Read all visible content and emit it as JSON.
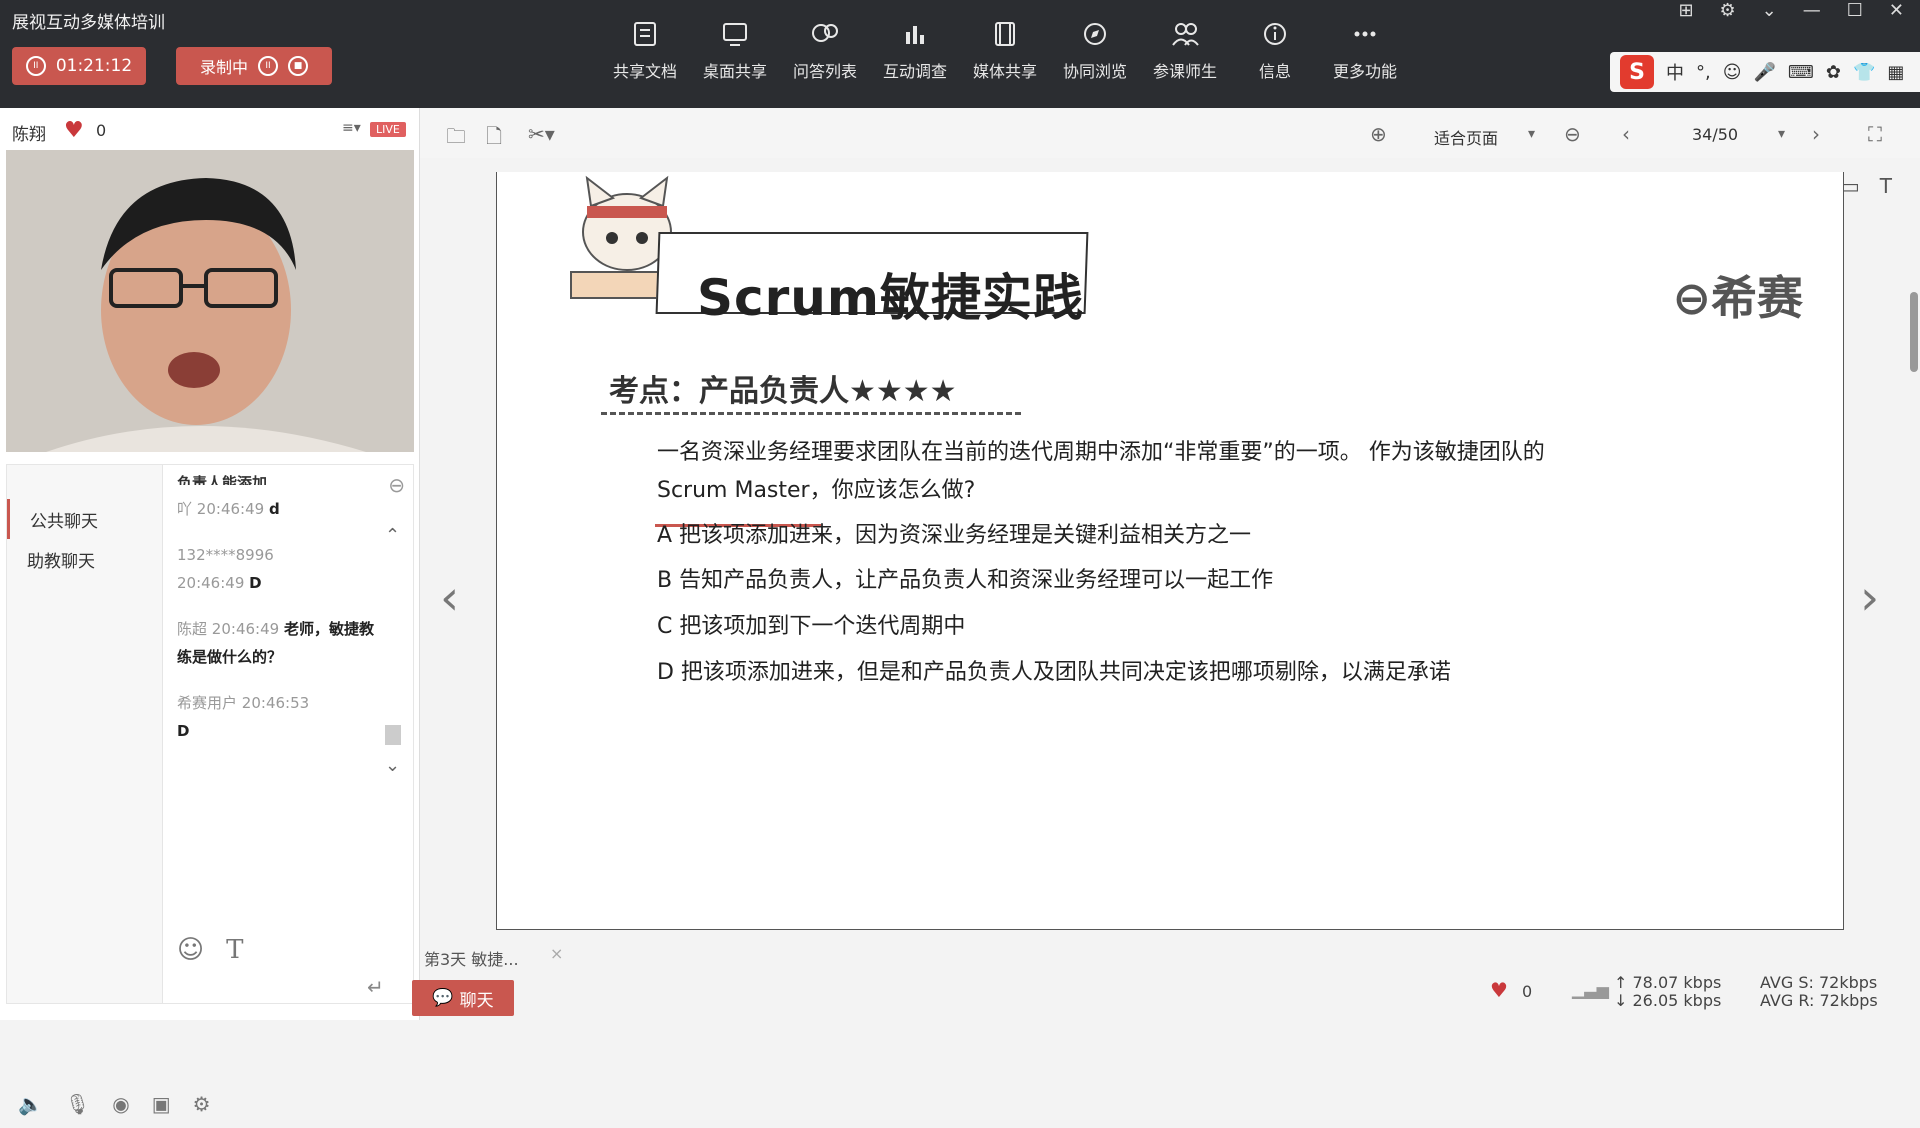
{
  "app": {
    "title": "展视互动多媒体培训"
  },
  "recording": {
    "time": "01:21:12",
    "label": "录制中"
  },
  "toolbar": {
    "items": [
      {
        "label": "共享文档",
        "icon": "document-share-icon"
      },
      {
        "label": "桌面共享",
        "icon": "desktop-share-icon"
      },
      {
        "label": "问答列表",
        "icon": "qa-list-icon"
      },
      {
        "label": "互动调查",
        "icon": "survey-chart-icon"
      },
      {
        "label": "媒体共享",
        "icon": "media-share-icon"
      },
      {
        "label": "协同浏览",
        "icon": "co-browse-icon"
      },
      {
        "label": "参课师生",
        "icon": "participants-icon"
      },
      {
        "label": "信息",
        "icon": "info-icon"
      },
      {
        "label": "更多功能",
        "icon": "more-icon"
      }
    ]
  },
  "presenter": {
    "name": "陈翔",
    "likes": "0",
    "live": "LIVE"
  },
  "chat": {
    "tabs": [
      "公共聊天",
      "助教聊天"
    ],
    "clipped_line": "负责人能添加",
    "messages": [
      {
        "user": "吖",
        "time": "20:46:49",
        "text": "d"
      },
      {
        "user": "132****8996",
        "time": "20:46:49",
        "text": "D"
      },
      {
        "user": "陈超",
        "time": "20:46:49",
        "text": "老师，敏捷教练是做什么的？"
      },
      {
        "user": "希赛用户",
        "time": "20:46:53",
        "text": "D"
      }
    ]
  },
  "doc": {
    "zoom": "适合页面",
    "page": "34/50",
    "slide": {
      "title": "Scrum敏捷实践",
      "brand": "希赛",
      "point": "考点：产品负责人★★★★",
      "question_1": "一名资深业务经理要求团队在当前的迭代周期中添加“非常重要”的一项。 作为该敏捷团队的",
      "question_2": "Scrum Master，你应该怎么做?",
      "options": [
        "A 把该项添加进来，因为资深业务经理是关键利益相关方之一",
        "B 告知产品负责人，让产品负责人和资深业务经理可以一起工作",
        "C 把该项加到下一个迭代周期中",
        "D 把该项添加进来，但是和产品负责人及团队共同决定该把哪项剔除，以满足承诺"
      ]
    },
    "tab_label": "第3天 敏捷...",
    "tab_close": "×"
  },
  "bottom": {
    "chat_label": "聊天",
    "likes": "0",
    "up": "78.07 kbps",
    "down": "26.05 kbps",
    "avg_s": "AVG S: 72kbps",
    "avg_r": "AVG R: 72kbps"
  },
  "colors": {
    "accent": "#c9574f",
    "topbar": "#2b2d31"
  }
}
